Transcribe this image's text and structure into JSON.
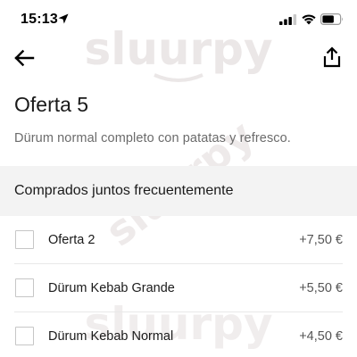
{
  "status_bar": {
    "time": "15:13",
    "icons": [
      "location-arrow-icon",
      "cellular-signal-icon",
      "wifi-icon",
      "battery-icon"
    ]
  },
  "nav": {
    "back_icon": "arrow-left-icon",
    "share_icon": "share-icon"
  },
  "item": {
    "title": "Oferta 5",
    "description": "Dürum normal completo con patatas y refresco."
  },
  "frequently_bought": {
    "header": "Comprados juntos frecuentemente",
    "options": [
      {
        "name": "Oferta 2",
        "price": "+7,50 €",
        "checked": false
      },
      {
        "name": "Dürum Kebab Grande",
        "price": "+5,50 €",
        "checked": false
      },
      {
        "name": "Dürum Kebab Normal",
        "price": "+4,50 €",
        "checked": false
      }
    ]
  },
  "watermark": {
    "text": "sluurpy",
    "color": "#e8e4e4"
  }
}
